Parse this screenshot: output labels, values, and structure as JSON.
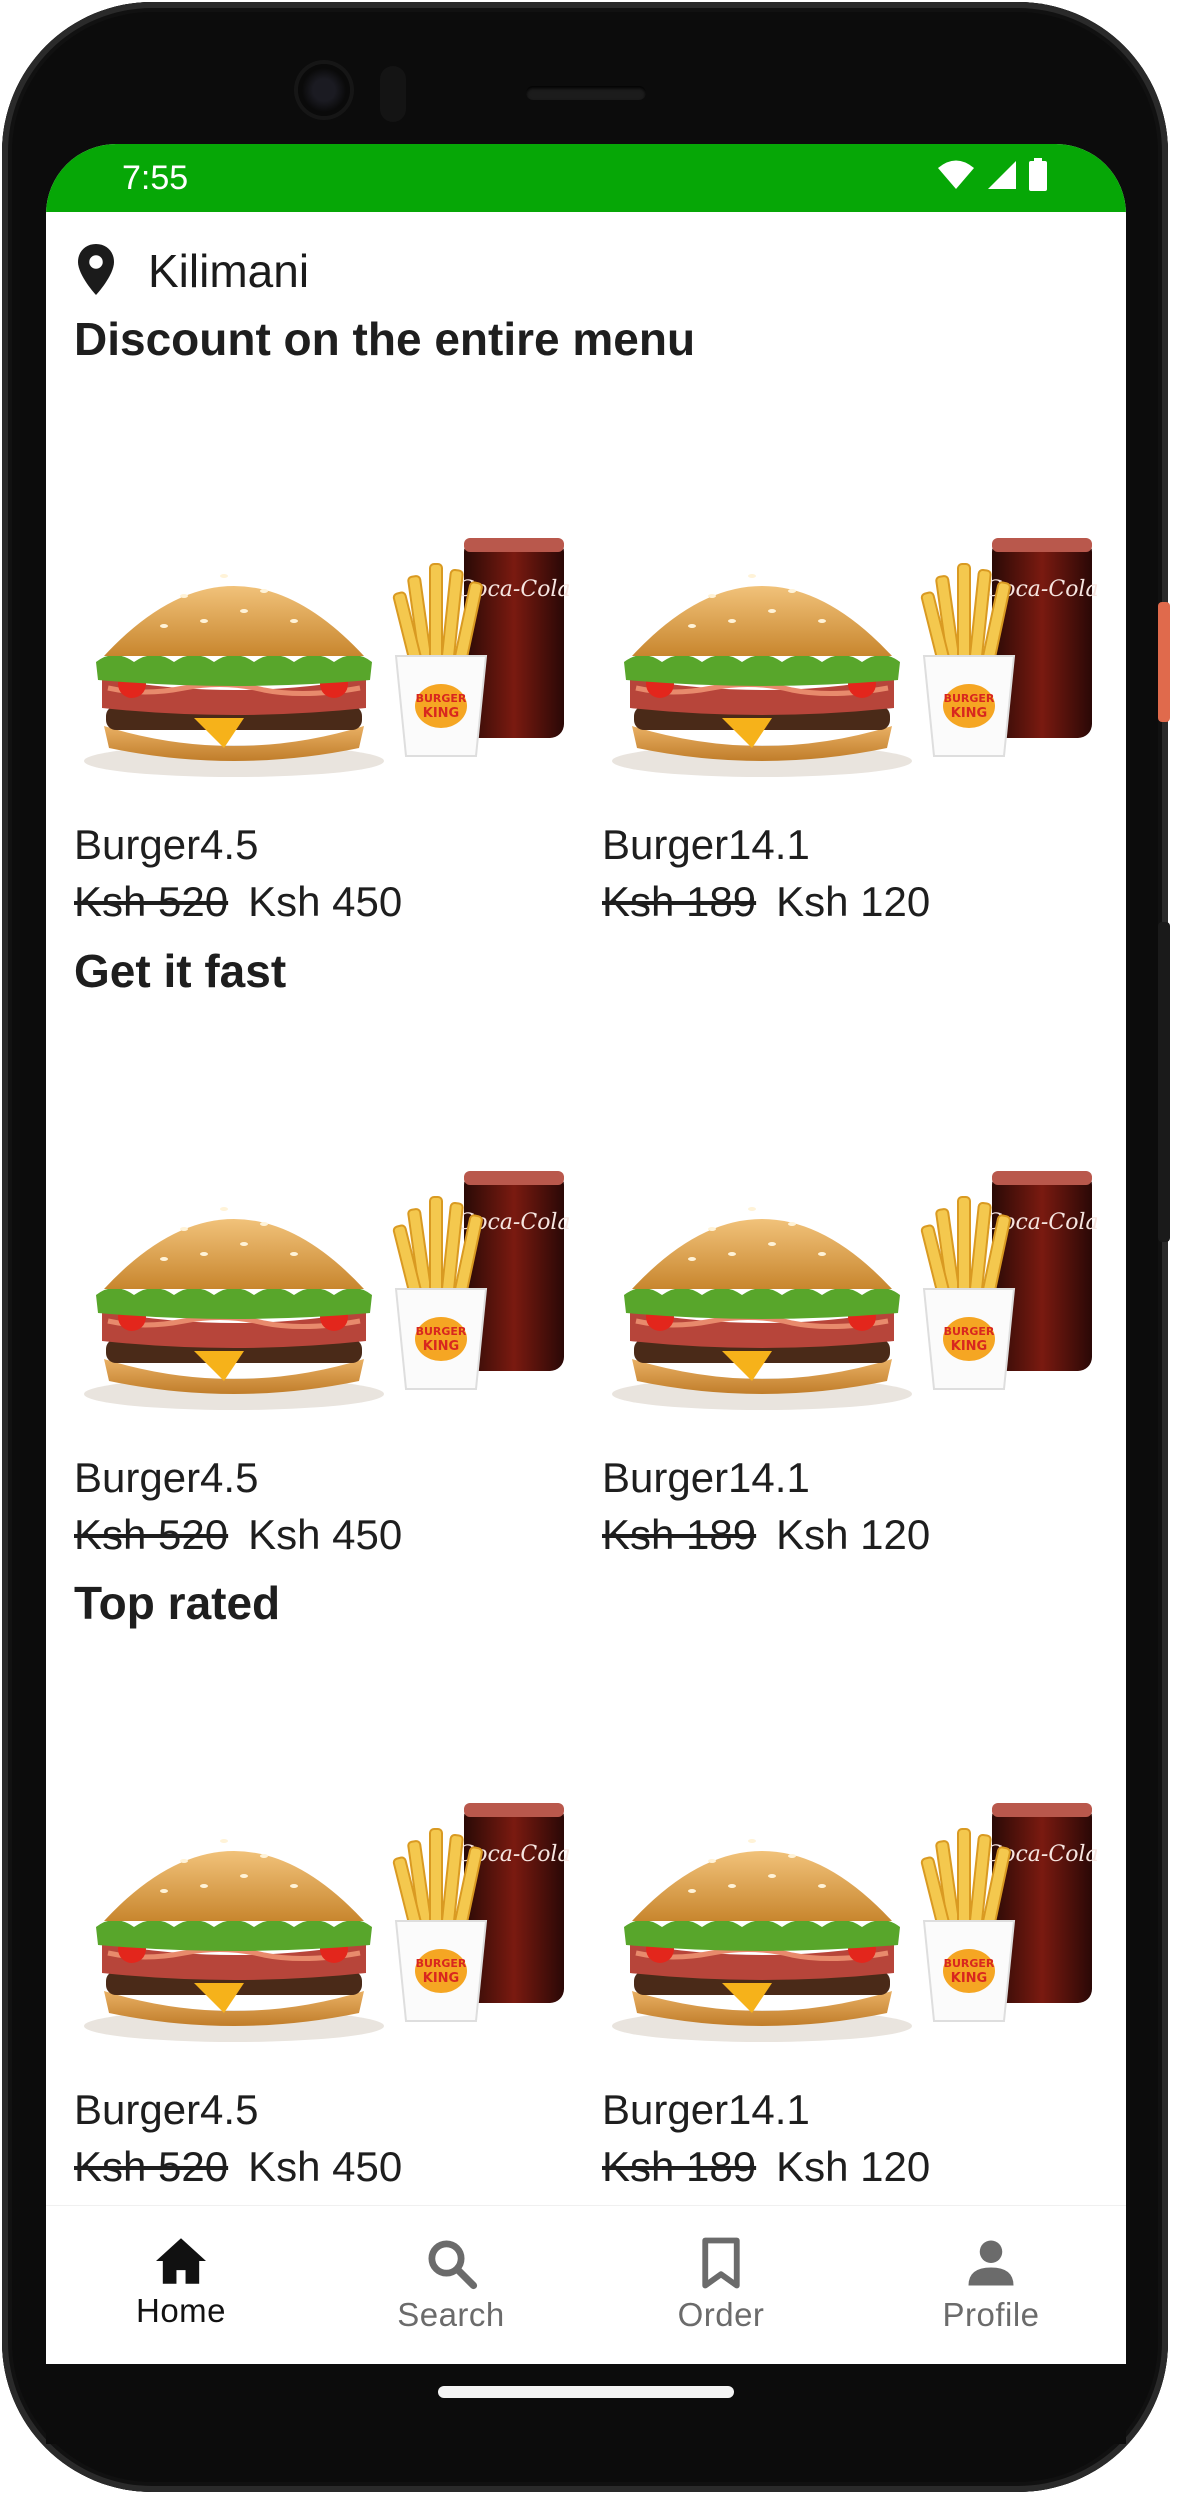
{
  "status_bar": {
    "time": "7:55"
  },
  "location": {
    "label": "Kilimani"
  },
  "sections": [
    {
      "title": "Discount on the entire menu",
      "items": [
        {
          "name": "Burger4.5",
          "old_price": "Ksh 520",
          "new_price": "Ksh 450"
        },
        {
          "name": "Burger14.1",
          "old_price": "Ksh 189",
          "new_price": "Ksh 120"
        }
      ]
    },
    {
      "title": "Get it fast",
      "items": [
        {
          "name": "Burger4.5",
          "old_price": "Ksh 520",
          "new_price": "Ksh 450"
        },
        {
          "name": "Burger14.1",
          "old_price": "Ksh 189",
          "new_price": "Ksh 120"
        }
      ]
    },
    {
      "title": "Top rated",
      "items": [
        {
          "name": "Burger4.5",
          "old_price": "Ksh 520",
          "new_price": "Ksh 450"
        },
        {
          "name": "Burger14.1",
          "old_price": "Ksh 189",
          "new_price": "Ksh 120"
        }
      ]
    }
  ],
  "bottom_nav": [
    {
      "label": "Home",
      "icon": "home-icon",
      "active": true
    },
    {
      "label": "Search",
      "icon": "search-icon",
      "active": false
    },
    {
      "label": "Order",
      "icon": "bookmark-icon",
      "active": false
    },
    {
      "label": "Profile",
      "icon": "person-icon",
      "active": false
    }
  ],
  "colors": {
    "status_bar": "#06a706",
    "text": "#1e1e1e",
    "nav_inactive": "#6b6b6b"
  }
}
